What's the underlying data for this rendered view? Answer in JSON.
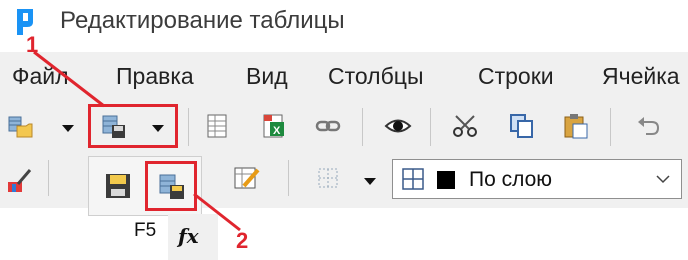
{
  "window": {
    "title": "Редактирование таблицы",
    "accent_color": "#1a93f5"
  },
  "menu": {
    "items": [
      "Файл",
      "Правка",
      "Вид",
      "Столбцы",
      "Строки",
      "Ячейка"
    ]
  },
  "toolbar1": {
    "buttons": [
      "open-folder-icon",
      "save-table-icon",
      "eye-icon",
      "cut-icon",
      "copy-icon",
      "paste-icon",
      "undo-icon",
      "grid-icon",
      "excel-icon",
      "link-icon"
    ]
  },
  "toolbar2": {
    "layer_combo_value": "По слою",
    "buttons": [
      "brush-icon",
      "table-icon",
      "grid-dots-icon",
      "pencil-table-icon"
    ]
  },
  "popup": {
    "items": [
      "save-icon",
      "save-table-icon"
    ]
  },
  "callouts": {
    "first": "1",
    "second": "2",
    "color": "#e0252e"
  },
  "bottom": {
    "fkey_label": "F5",
    "fx_label": "fx"
  }
}
